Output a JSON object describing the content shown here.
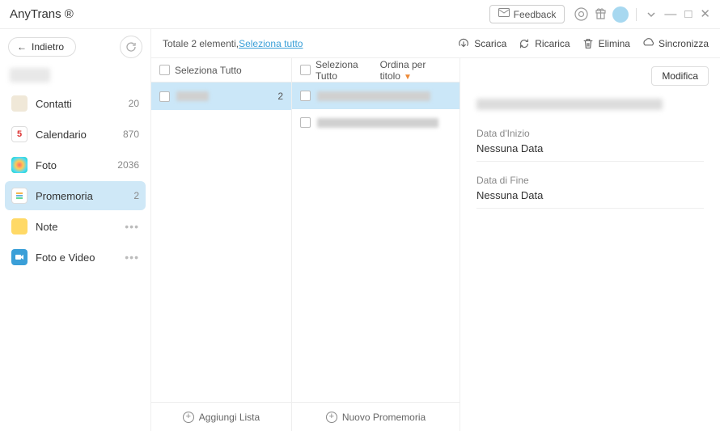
{
  "app_title": "AnyTrans ®",
  "feedback_label": "Feedback",
  "back_label": "Indietro",
  "sidebar": {
    "items": [
      {
        "label": "Contatti",
        "count": "20"
      },
      {
        "label": "Calendario",
        "count": "870"
      },
      {
        "label": "Foto",
        "count": "2036"
      },
      {
        "label": "Promemoria",
        "count": "2"
      },
      {
        "label": "Note",
        "count": ""
      },
      {
        "label": "Foto e Video",
        "count": ""
      }
    ]
  },
  "toolbar": {
    "total_prefix": "Totale ",
    "total_count": "2",
    "total_suffix": " elementi, ",
    "select_all_link": "Seleziona tutto",
    "download": "Scarica",
    "reload": "Ricarica",
    "delete": "Elimina",
    "sync": "Sincronizza"
  },
  "col1": {
    "header": "Seleziona Tutto",
    "row_count": "2",
    "footer": "Aggiungi Lista"
  },
  "col2": {
    "header": "Seleziona Tutto",
    "sort": "Ordina per titolo",
    "footer": "Nuovo Promemoria"
  },
  "detail": {
    "modify": "Modifica",
    "start_label": "Data d'Inizio",
    "start_value": "Nessuna Data",
    "end_label": "Data di Fine",
    "end_value": "Nessuna Data"
  }
}
